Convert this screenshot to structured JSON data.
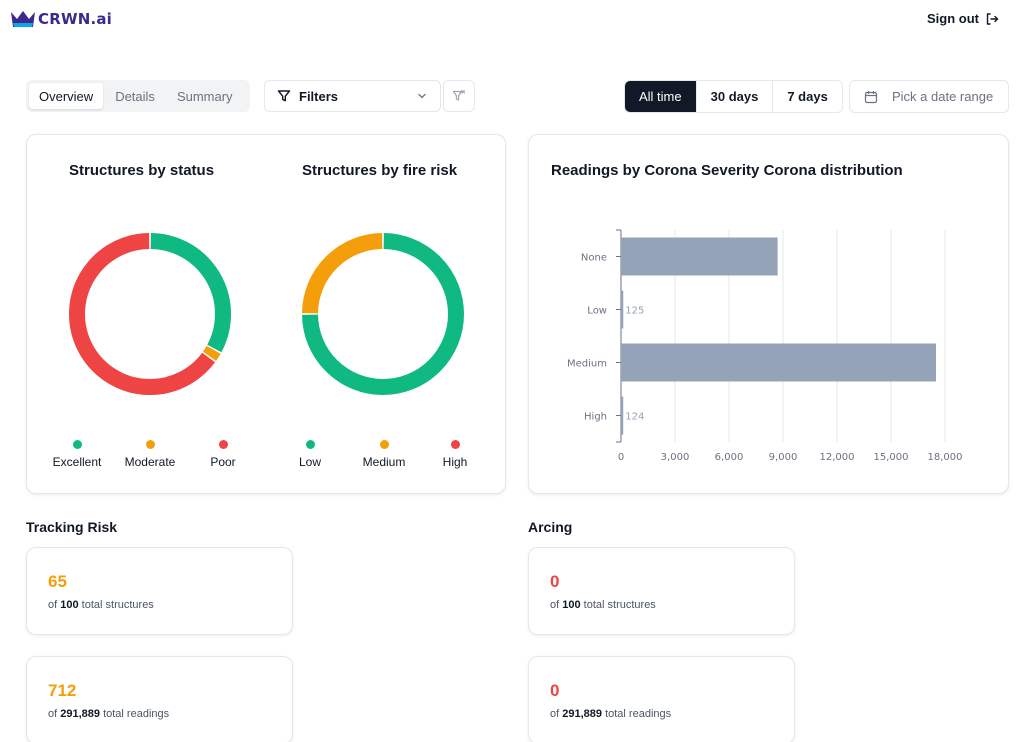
{
  "header": {
    "logo_text": "CRWN.ai",
    "sign_out_label": "Sign out"
  },
  "toolbar": {
    "tabs": [
      {
        "label": "Overview",
        "active": true
      },
      {
        "label": "Details",
        "active": false
      },
      {
        "label": "Summary",
        "active": false
      }
    ],
    "filters_label": "Filters",
    "ranges": [
      {
        "label": "All time",
        "active": true
      },
      {
        "label": "30 days",
        "active": false
      },
      {
        "label": "7 days",
        "active": false
      }
    ],
    "date_placeholder": "Pick a date range"
  },
  "colors": {
    "green": "#10b981",
    "orange": "#f59e0b",
    "red": "#ef4444",
    "bar": "#94a3b8",
    "accent_value": "#f59e0b",
    "zero_value": "#ef4444"
  },
  "status_chart": {
    "title": "Structures by status",
    "legend": [
      {
        "label": "Excellent",
        "color": "#10b981"
      },
      {
        "label": "Moderate",
        "color": "#f59e0b"
      },
      {
        "label": "Poor",
        "color": "#ef4444"
      }
    ]
  },
  "risk_chart": {
    "title": "Structures by fire risk",
    "legend": [
      {
        "label": "Low",
        "color": "#10b981"
      },
      {
        "label": "Medium",
        "color": "#f59e0b"
      },
      {
        "label": "High",
        "color": "#ef4444"
      }
    ]
  },
  "chart_data": [
    {
      "type": "pie",
      "title": "Structures by status",
      "categories": [
        "Excellent",
        "Moderate",
        "Poor"
      ],
      "values": [
        33,
        2,
        65
      ],
      "colors": [
        "#10b981",
        "#f59e0b",
        "#ef4444"
      ]
    },
    {
      "type": "pie",
      "title": "Structures by fire risk",
      "categories": [
        "Low",
        "Medium",
        "High"
      ],
      "values": [
        75,
        25,
        0
      ],
      "colors": [
        "#10b981",
        "#f59e0b",
        "#ef4444"
      ]
    },
    {
      "type": "bar",
      "orientation": "horizontal",
      "title": "Readings by Corona Severity Corona distribution",
      "categories": [
        "None",
        "Low",
        "Medium",
        "High"
      ],
      "values": [
        8700,
        125,
        17500,
        124
      ],
      "data_labels": [
        "",
        "125",
        "",
        "124"
      ],
      "xticks": [
        "0",
        "3,000",
        "6,000",
        "9,000",
        "12,000",
        "15,000",
        "18,000"
      ],
      "xlim": [
        0,
        18000
      ],
      "grid": true
    }
  ],
  "tracking_risk": {
    "title": "Tracking Risk",
    "structures": {
      "value": "65",
      "prefix": "of",
      "total": "100",
      "suffix": "total structures"
    },
    "readings": {
      "value": "712",
      "prefix": "of",
      "total": "291,889",
      "suffix": "total readings"
    }
  },
  "arcing": {
    "title": "Arcing",
    "structures": {
      "value": "0",
      "prefix": "of",
      "total": "100",
      "suffix": "total structures"
    },
    "readings": {
      "value": "0",
      "prefix": "of",
      "total": "291,889",
      "suffix": "total readings"
    }
  }
}
